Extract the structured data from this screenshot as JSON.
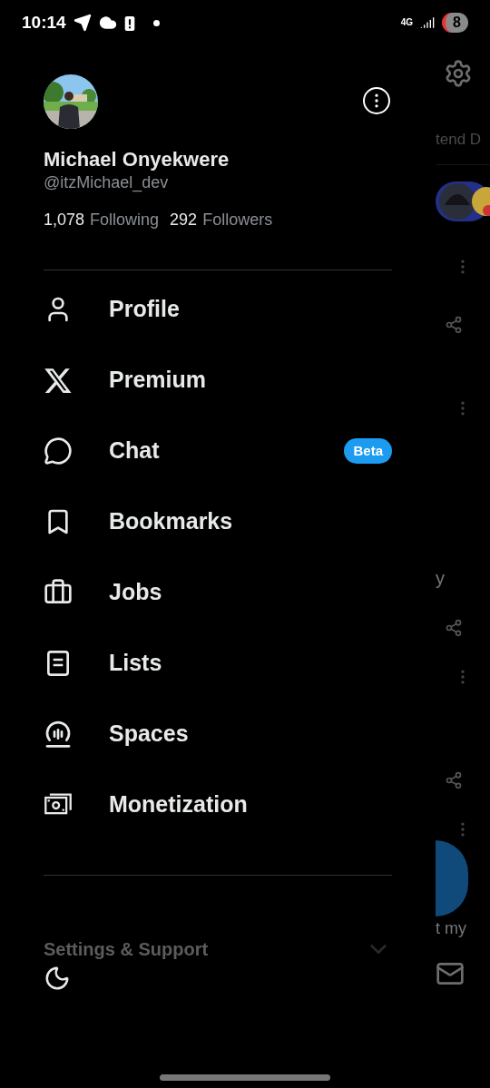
{
  "status_bar": {
    "time": "10:14",
    "network": "4G",
    "battery": "8"
  },
  "profile": {
    "name": "Michael Onyekwere",
    "handle": "@itzMichael_dev",
    "following_count": "1,078",
    "following_label": "Following",
    "followers_count": "292",
    "followers_label": "Followers"
  },
  "menu": [
    {
      "label": "Profile"
    },
    {
      "label": "Premium"
    },
    {
      "label": "Chat",
      "badge": "Beta"
    },
    {
      "label": "Bookmarks"
    },
    {
      "label": "Jobs"
    },
    {
      "label": "Lists"
    },
    {
      "label": "Spaces"
    },
    {
      "label": "Monetization"
    }
  ],
  "settings_section": {
    "label": "Settings & Support",
    "expanded": false
  },
  "background_feed": {
    "texts": [
      "tend D",
      "y",
      "t my"
    ]
  }
}
